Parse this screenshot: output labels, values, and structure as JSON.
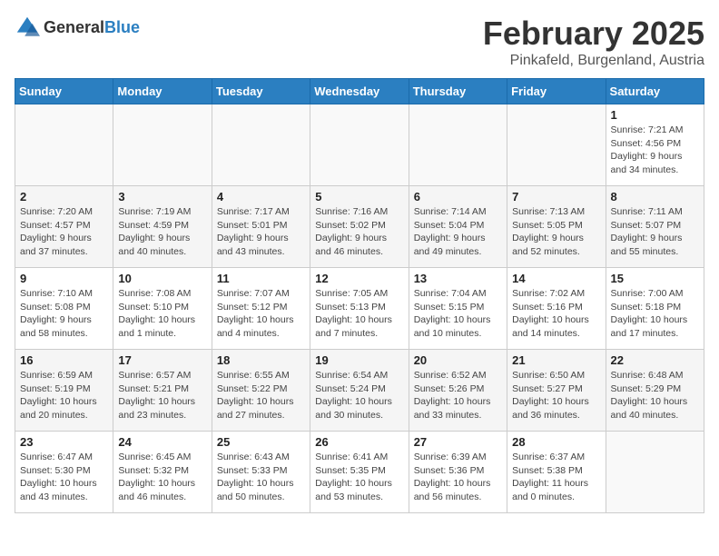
{
  "header": {
    "logo_general": "General",
    "logo_blue": "Blue",
    "month": "February 2025",
    "location": "Pinkafeld, Burgenland, Austria"
  },
  "weekdays": [
    "Sunday",
    "Monday",
    "Tuesday",
    "Wednesday",
    "Thursday",
    "Friday",
    "Saturday"
  ],
  "weeks": [
    [
      {
        "day": "",
        "info": ""
      },
      {
        "day": "",
        "info": ""
      },
      {
        "day": "",
        "info": ""
      },
      {
        "day": "",
        "info": ""
      },
      {
        "day": "",
        "info": ""
      },
      {
        "day": "",
        "info": ""
      },
      {
        "day": "1",
        "info": "Sunrise: 7:21 AM\nSunset: 4:56 PM\nDaylight: 9 hours\nand 34 minutes."
      }
    ],
    [
      {
        "day": "2",
        "info": "Sunrise: 7:20 AM\nSunset: 4:57 PM\nDaylight: 9 hours\nand 37 minutes."
      },
      {
        "day": "3",
        "info": "Sunrise: 7:19 AM\nSunset: 4:59 PM\nDaylight: 9 hours\nand 40 minutes."
      },
      {
        "day": "4",
        "info": "Sunrise: 7:17 AM\nSunset: 5:01 PM\nDaylight: 9 hours\nand 43 minutes."
      },
      {
        "day": "5",
        "info": "Sunrise: 7:16 AM\nSunset: 5:02 PM\nDaylight: 9 hours\nand 46 minutes."
      },
      {
        "day": "6",
        "info": "Sunrise: 7:14 AM\nSunset: 5:04 PM\nDaylight: 9 hours\nand 49 minutes."
      },
      {
        "day": "7",
        "info": "Sunrise: 7:13 AM\nSunset: 5:05 PM\nDaylight: 9 hours\nand 52 minutes."
      },
      {
        "day": "8",
        "info": "Sunrise: 7:11 AM\nSunset: 5:07 PM\nDaylight: 9 hours\nand 55 minutes."
      }
    ],
    [
      {
        "day": "9",
        "info": "Sunrise: 7:10 AM\nSunset: 5:08 PM\nDaylight: 9 hours\nand 58 minutes."
      },
      {
        "day": "10",
        "info": "Sunrise: 7:08 AM\nSunset: 5:10 PM\nDaylight: 10 hours\nand 1 minute."
      },
      {
        "day": "11",
        "info": "Sunrise: 7:07 AM\nSunset: 5:12 PM\nDaylight: 10 hours\nand 4 minutes."
      },
      {
        "day": "12",
        "info": "Sunrise: 7:05 AM\nSunset: 5:13 PM\nDaylight: 10 hours\nand 7 minutes."
      },
      {
        "day": "13",
        "info": "Sunrise: 7:04 AM\nSunset: 5:15 PM\nDaylight: 10 hours\nand 10 minutes."
      },
      {
        "day": "14",
        "info": "Sunrise: 7:02 AM\nSunset: 5:16 PM\nDaylight: 10 hours\nand 14 minutes."
      },
      {
        "day": "15",
        "info": "Sunrise: 7:00 AM\nSunset: 5:18 PM\nDaylight: 10 hours\nand 17 minutes."
      }
    ],
    [
      {
        "day": "16",
        "info": "Sunrise: 6:59 AM\nSunset: 5:19 PM\nDaylight: 10 hours\nand 20 minutes."
      },
      {
        "day": "17",
        "info": "Sunrise: 6:57 AM\nSunset: 5:21 PM\nDaylight: 10 hours\nand 23 minutes."
      },
      {
        "day": "18",
        "info": "Sunrise: 6:55 AM\nSunset: 5:22 PM\nDaylight: 10 hours\nand 27 minutes."
      },
      {
        "day": "19",
        "info": "Sunrise: 6:54 AM\nSunset: 5:24 PM\nDaylight: 10 hours\nand 30 minutes."
      },
      {
        "day": "20",
        "info": "Sunrise: 6:52 AM\nSunset: 5:26 PM\nDaylight: 10 hours\nand 33 minutes."
      },
      {
        "day": "21",
        "info": "Sunrise: 6:50 AM\nSunset: 5:27 PM\nDaylight: 10 hours\nand 36 minutes."
      },
      {
        "day": "22",
        "info": "Sunrise: 6:48 AM\nSunset: 5:29 PM\nDaylight: 10 hours\nand 40 minutes."
      }
    ],
    [
      {
        "day": "23",
        "info": "Sunrise: 6:47 AM\nSunset: 5:30 PM\nDaylight: 10 hours\nand 43 minutes."
      },
      {
        "day": "24",
        "info": "Sunrise: 6:45 AM\nSunset: 5:32 PM\nDaylight: 10 hours\nand 46 minutes."
      },
      {
        "day": "25",
        "info": "Sunrise: 6:43 AM\nSunset: 5:33 PM\nDaylight: 10 hours\nand 50 minutes."
      },
      {
        "day": "26",
        "info": "Sunrise: 6:41 AM\nSunset: 5:35 PM\nDaylight: 10 hours\nand 53 minutes."
      },
      {
        "day": "27",
        "info": "Sunrise: 6:39 AM\nSunset: 5:36 PM\nDaylight: 10 hours\nand 56 minutes."
      },
      {
        "day": "28",
        "info": "Sunrise: 6:37 AM\nSunset: 5:38 PM\nDaylight: 11 hours\nand 0 minutes."
      },
      {
        "day": "",
        "info": ""
      }
    ]
  ]
}
